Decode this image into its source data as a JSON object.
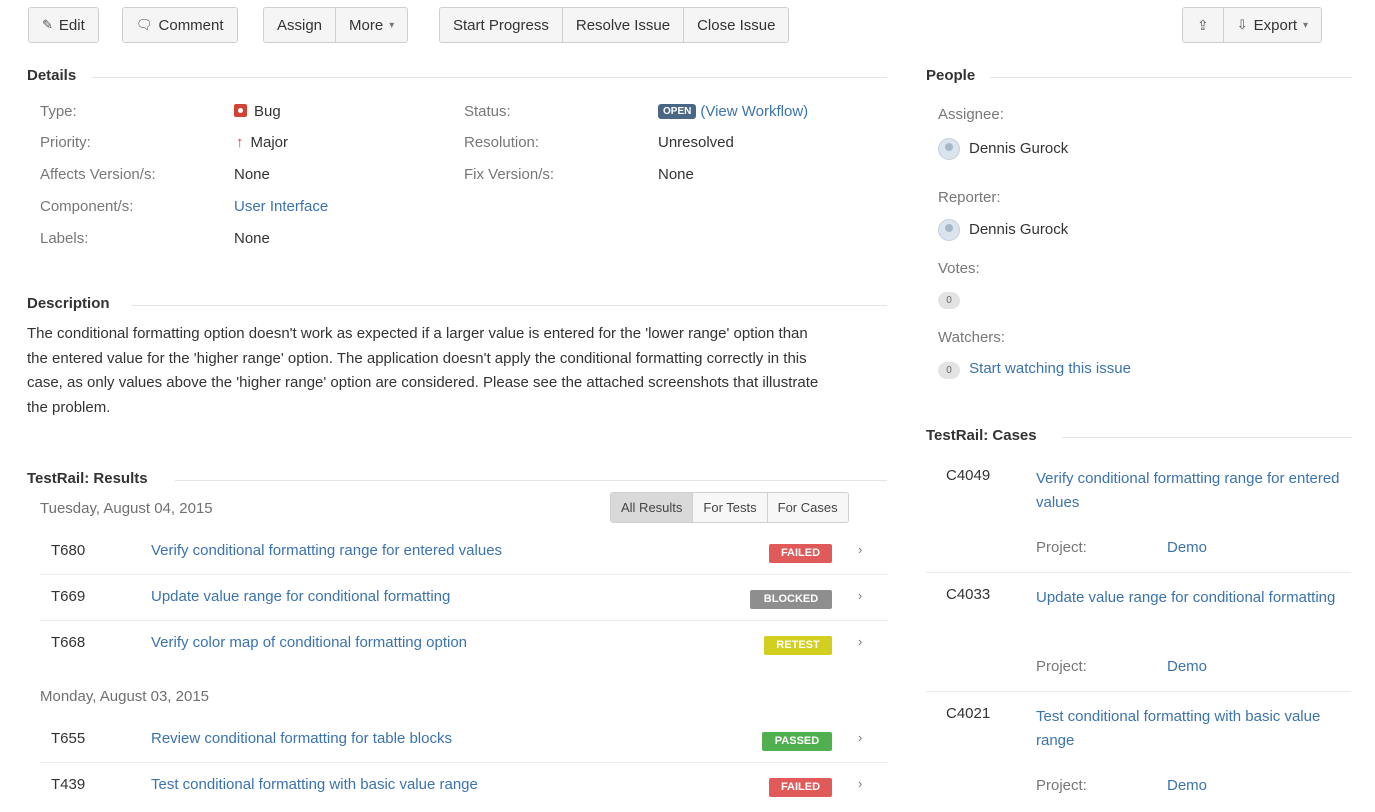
{
  "toolbar": {
    "edit": "Edit",
    "comment": "Comment",
    "assign": "Assign",
    "more": "More",
    "start_progress": "Start Progress",
    "resolve_issue": "Resolve Issue",
    "close_issue": "Close Issue",
    "export": "Export"
  },
  "details": {
    "heading": "Details",
    "type_label": "Type:",
    "type_value": "Bug",
    "priority_label": "Priority:",
    "priority_value": "Major",
    "affects_label": "Affects Version/s:",
    "affects_value": "None",
    "component_label": "Component/s:",
    "component_value": "User Interface",
    "labels_label": "Labels:",
    "labels_value": "None",
    "status_label": "Status:",
    "status_value": "OPEN",
    "status_link": "(View Workflow)",
    "resolution_label": "Resolution:",
    "resolution_value": "Unresolved",
    "fix_label": "Fix Version/s:",
    "fix_value": "None"
  },
  "description": {
    "heading": "Description",
    "text": "The conditional formatting option doesn't work as expected if a larger value is entered for the 'lower range' option than the entered value for the 'higher range' option. The application doesn't apply the conditional formatting correctly in this case, as only values above the 'higher range' option are considered. Please see the attached screenshots that illustrate the problem."
  },
  "results": {
    "heading": "TestRail: Results",
    "filters": [
      "All Results",
      "For Tests",
      "For Cases"
    ],
    "groups": [
      {
        "date": "Tuesday, August 04, 2015",
        "rows": [
          {
            "id": "T680",
            "title": "Verify conditional formatting range for entered values",
            "status": "FAILED"
          },
          {
            "id": "T669",
            "title": "Update value range for conditional formatting",
            "status": "BLOCKED"
          },
          {
            "id": "T668",
            "title": "Verify color map of conditional formatting option",
            "status": "RETEST"
          }
        ]
      },
      {
        "date": "Monday, August 03, 2015",
        "rows": [
          {
            "id": "T655",
            "title": "Review conditional formatting for table blocks",
            "status": "PASSED"
          },
          {
            "id": "T439",
            "title": "Test conditional formatting with basic value range",
            "status": "FAILED"
          }
        ]
      }
    ]
  },
  "status_colors": {
    "FAILED": "#e05a5a",
    "BLOCKED": "#8e8e8e",
    "RETEST": "#d2cf1f",
    "PASSED": "#50b050",
    "OPEN": "#4a6785"
  },
  "people": {
    "heading": "People",
    "assignee_label": "Assignee:",
    "assignee": "Dennis Gurock",
    "reporter_label": "Reporter:",
    "reporter": "Dennis Gurock",
    "votes_label": "Votes:",
    "votes": "0",
    "watchers_label": "Watchers:",
    "watchers": "0",
    "watch_link": "Start watching this issue"
  },
  "cases": {
    "heading": "TestRail: Cases",
    "project_label": "Project:",
    "items": [
      {
        "id": "C4049",
        "title": "Verify conditional formatting range for entered values",
        "project": "Demo"
      },
      {
        "id": "C4033",
        "title": "Update value range for conditional formatting",
        "project": "Demo"
      },
      {
        "id": "C4021",
        "title": "Test conditional formatting with basic value range",
        "project": "Demo"
      }
    ]
  }
}
